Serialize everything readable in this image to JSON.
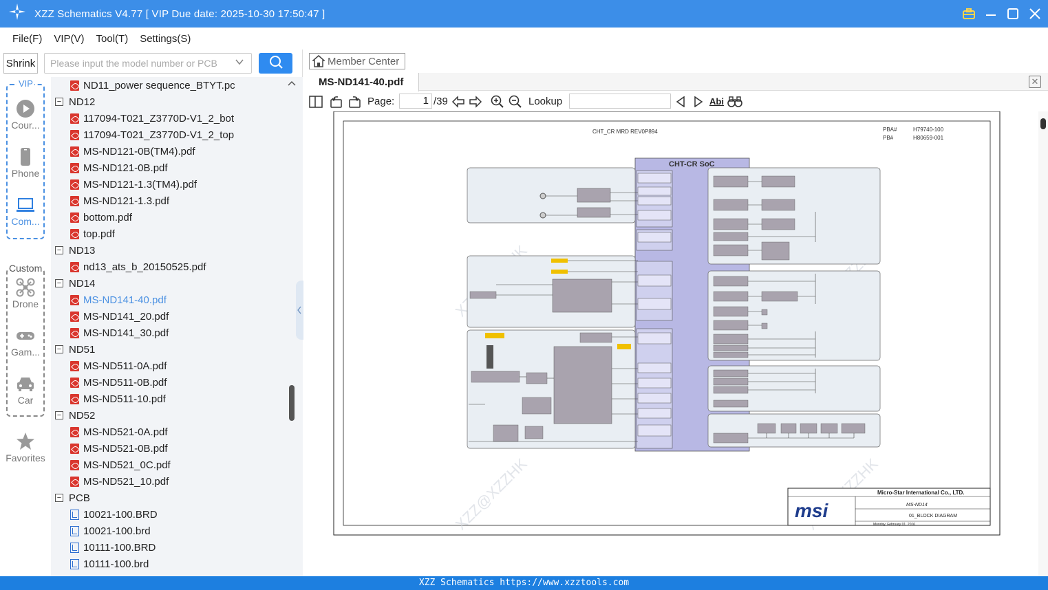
{
  "titlebar": {
    "title": "XZZ Schematics V4.77 [ VIP Due date: 2025-10-30 17:50:47 ]"
  },
  "menu": [
    "File(F)",
    "VIP(V)",
    "Tool(T)",
    "Settings(S)"
  ],
  "left": {
    "shrink_label": "Shrink",
    "search_placeholder": "Please input the model number or PCB",
    "vip_label": "VIP",
    "custom_label": "Custom",
    "categories": [
      {
        "label": "Cour...",
        "icon": "play-circle-icon"
      },
      {
        "label": "Phone",
        "icon": "phone-icon"
      },
      {
        "label": "Com...",
        "icon": "laptop-icon"
      },
      {
        "label": "Drone",
        "icon": "drone-icon"
      },
      {
        "label": "Gam...",
        "icon": "gamepad-icon"
      },
      {
        "label": "Car",
        "icon": "car-icon"
      },
      {
        "label": "Favorites",
        "icon": "star-icon"
      }
    ],
    "tree": [
      {
        "label": "ND11_power sequence_BTYT.pc",
        "kind": "pdf"
      },
      {
        "label": "ND12",
        "kind": "folder"
      },
      {
        "label": "117094-T021_Z3770D-V1_2_bot",
        "kind": "pdf"
      },
      {
        "label": "117094-T021_Z3770D-V1_2_top",
        "kind": "pdf"
      },
      {
        "label": "MS-ND121-0B(TM4).pdf",
        "kind": "pdf"
      },
      {
        "label": "MS-ND121-0B.pdf",
        "kind": "pdf"
      },
      {
        "label": "MS-ND121-1.3(TM4).pdf",
        "kind": "pdf"
      },
      {
        "label": "MS-ND121-1.3.pdf",
        "kind": "pdf"
      },
      {
        "label": "bottom.pdf",
        "kind": "pdf"
      },
      {
        "label": "top.pdf",
        "kind": "pdf"
      },
      {
        "label": "ND13",
        "kind": "folder"
      },
      {
        "label": "nd13_ats_b_20150525.pdf",
        "kind": "pdf"
      },
      {
        "label": "ND14",
        "kind": "folder"
      },
      {
        "label": "MS-ND141-40.pdf",
        "kind": "pdf",
        "selected": true
      },
      {
        "label": "MS-ND141_20.pdf",
        "kind": "pdf"
      },
      {
        "label": "MS-ND141_30.pdf",
        "kind": "pdf"
      },
      {
        "label": "ND51",
        "kind": "folder"
      },
      {
        "label": "MS-ND511-0A.pdf",
        "kind": "pdf"
      },
      {
        "label": "MS-ND511-0B.pdf",
        "kind": "pdf"
      },
      {
        "label": "MS-ND511-10.pdf",
        "kind": "pdf"
      },
      {
        "label": "ND52",
        "kind": "folder"
      },
      {
        "label": "MS-ND521-0A.pdf",
        "kind": "pdf"
      },
      {
        "label": "MS-ND521-0B.pdf",
        "kind": "pdf"
      },
      {
        "label": "MS-ND521_0C.pdf",
        "kind": "pdf"
      },
      {
        "label": "MS-ND521_10.pdf",
        "kind": "pdf"
      },
      {
        "label": "PCB",
        "kind": "folder"
      },
      {
        "label": "10021-100.BRD",
        "kind": "brd"
      },
      {
        "label": "10021-100.brd",
        "kind": "brd"
      },
      {
        "label": "10111-100.BRD",
        "kind": "brd"
      },
      {
        "label": "10111-100.brd",
        "kind": "brd"
      }
    ]
  },
  "right": {
    "member_center": "Member Center",
    "tab_title": "MS-ND141-40.pdf",
    "page_label": "Page:",
    "page_current": "1",
    "page_total": "/39",
    "lookup_label": "Lookup",
    "abi_label": "Abi"
  },
  "schematic": {
    "header_left": "CHT_CR MRD REV0P894",
    "pba_label": "PBA#",
    "pba_value": "H79740-100",
    "pb_label": "PB#",
    "pb_value": "H80659-001",
    "soc_title": "CHT-CR SoC",
    "company": "Micro-Star International Co., LTD.",
    "doc_model": "MS-ND14",
    "doc_title": "01_BLOCK DIAGRAM",
    "date_text": "Monday, February 01, 2016",
    "brand": "msi",
    "watermark": "XZZ@XZZHK"
  },
  "footer": {
    "text": "XZZ Schematics https://www.xzztools.com"
  }
}
